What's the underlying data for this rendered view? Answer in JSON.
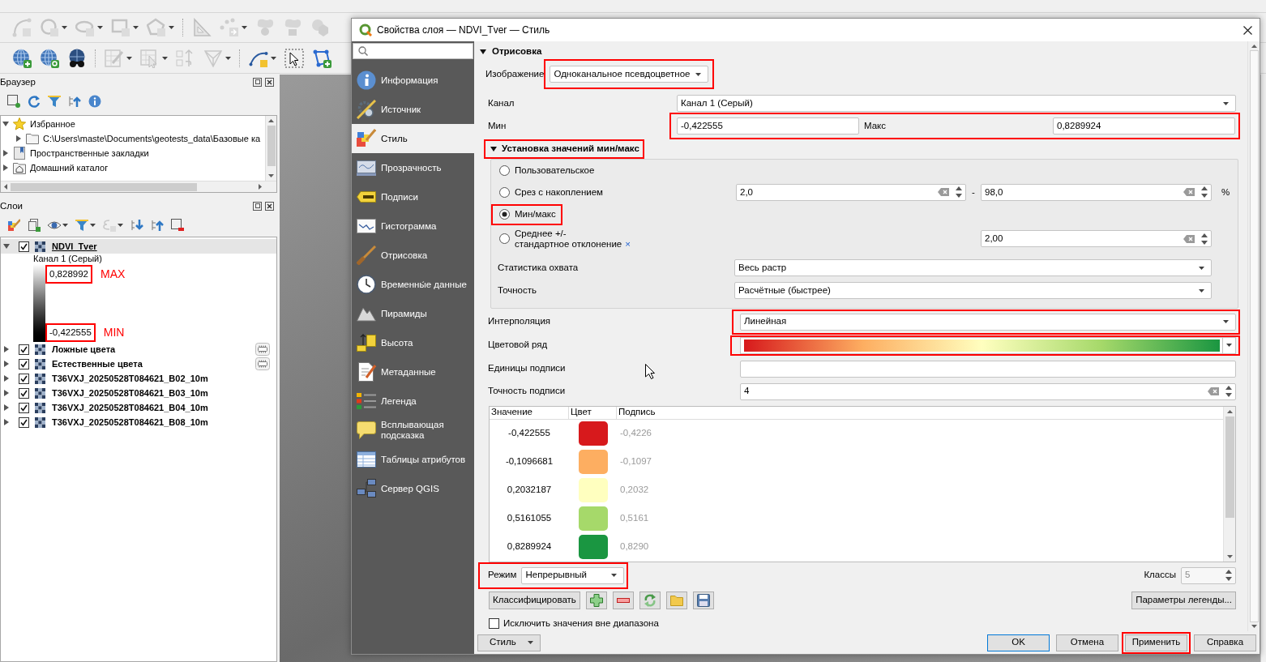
{
  "browser_panel": {
    "title": "Браузер",
    "items": [
      {
        "label": "Избранное",
        "expanded": true,
        "children": [
          {
            "label": "C:\\Users\\maste\\Documents\\geotests_data\\Базовые ка",
            "expanded": false
          }
        ]
      },
      {
        "label": "Пространственные закладки",
        "expanded": false
      },
      {
        "label": "Домашний каталог",
        "expanded": false
      }
    ]
  },
  "layers_panel": {
    "title": "Слои",
    "layers": [
      {
        "name": "NDVI_Tver",
        "checked": true,
        "expanded": true,
        "selected": true,
        "indicator": false,
        "legend": {
          "band": "Канал 1 (Серый)",
          "max": {
            "value": "0,828992",
            "note": "MAX",
            "highlighted": true
          },
          "min": {
            "value": "-0,422555",
            "note": "MIN",
            "highlighted": true
          }
        }
      },
      {
        "name": "Ложные цвета",
        "checked": true,
        "expanded": false,
        "selected": false,
        "indicator": true
      },
      {
        "name": "Естественные цвета",
        "checked": true,
        "expanded": false,
        "selected": false,
        "indicator": true
      },
      {
        "name": "T36VXJ_20250528T084621_B02_10m",
        "checked": true,
        "expanded": false,
        "selected": false,
        "indicator": false
      },
      {
        "name": "T36VXJ_20250528T084621_B03_10m",
        "checked": true,
        "expanded": false,
        "selected": false,
        "indicator": false
      },
      {
        "name": "T36VXJ_20250528T084621_B04_10m",
        "checked": true,
        "expanded": false,
        "selected": false,
        "indicator": false
      },
      {
        "name": "T36VXJ_20250528T084621_B08_10m",
        "checked": true,
        "expanded": false,
        "selected": false,
        "indicator": false
      }
    ]
  },
  "dialog": {
    "title": "Свойства слоя — NDVI_Tver — Стиль",
    "sections": [
      {
        "label": "Информация",
        "selected": false
      },
      {
        "label": "Источник",
        "selected": false
      },
      {
        "label": "Стиль",
        "selected": true
      },
      {
        "label": "Прозрачность",
        "selected": false
      },
      {
        "label": "Подписи",
        "selected": false
      },
      {
        "label": "Гистограмма",
        "selected": false
      },
      {
        "label": "Отрисовка",
        "selected": false
      },
      {
        "label": "Временны́е данные",
        "selected": false
      },
      {
        "label": "Пирамиды",
        "selected": false
      },
      {
        "label": "Высота",
        "selected": false
      },
      {
        "label": "Метаданные",
        "selected": false
      },
      {
        "label": "Легенда",
        "selected": false
      },
      {
        "label": "Всплывающая подсказка",
        "selected": false
      },
      {
        "label": "Таблицы атрибутов",
        "selected": false
      },
      {
        "label": "Сервер QGIS",
        "selected": false
      }
    ],
    "render": {
      "title": "Отрисовка",
      "expanded": true,
      "image": {
        "label": "Изображение",
        "value": "Одноканальное псевдоцветное",
        "highlighted": true
      },
      "band": {
        "label": "Канал",
        "value": "Канал 1 (Серый)"
      },
      "min": {
        "label": "Мин",
        "value": "-0,422555"
      },
      "max": {
        "label": "Макс",
        "value": "0,8289924"
      },
      "range_highlighted": true,
      "minmax": {
        "title": "Установка значений мин/макс",
        "expanded": true,
        "highlighted": true,
        "options": [
          {
            "kind": "plain",
            "label": "Пользовательское",
            "selected": false,
            "highlighted": false
          },
          {
            "kind": "cumulative",
            "label": "Срез с накоплением",
            "selected": false,
            "highlighted": false,
            "from": "2,0",
            "separator": "-",
            "to": "98,0",
            "unit": "%"
          },
          {
            "kind": "plain",
            "label": "Мин/макс",
            "selected": true,
            "highlighted": true
          },
          {
            "kind": "stddev",
            "label": "Среднее +/-\nстандартное отклонение",
            "mark": "×",
            "selected": false,
            "highlighted": false,
            "value": "2,00"
          }
        ],
        "extent": {
          "label": "Статистика охвата",
          "value": "Весь растр"
        },
        "accuracy": {
          "label": "Точность",
          "value": "Расчётные (быстрее)"
        }
      },
      "interpolation": {
        "label": "Интерполяция",
        "value": "Линейная",
        "highlighted": true
      },
      "color_ramp": {
        "label": "Цветовой ряд",
        "highlighted": true
      },
      "label_unit": {
        "label": "Единицы подписи"
      },
      "label_precision": {
        "label": "Точность подписи",
        "value": "4"
      },
      "table": {
        "columns": [
          "Значение",
          "Цвет",
          "Подпись"
        ],
        "rows": [
          {
            "value": "-0,422555",
            "color": "#d7191c",
            "label": "-0,4226"
          },
          {
            "value": "-0,1096681",
            "color": "#fdae61",
            "label": "-0,1097"
          },
          {
            "value": "0,2032187",
            "color": "#ffffbf",
            "label": "0,2032"
          },
          {
            "value": "0,5161055",
            "color": "#a6d96a",
            "label": "0,5161"
          },
          {
            "value": "0,8289924",
            "color": "#1a9641",
            "label": "0,8290"
          }
        ]
      },
      "mode": {
        "label": "Режим",
        "value": "Непрерывный",
        "highlighted": true
      },
      "classes": {
        "label": "Классы",
        "value": "5",
        "disabled": true
      },
      "classify_button": "Классифицировать",
      "legend_button": "Параметры легенды...",
      "clip": {
        "label": "Исключить значения вне диапазона",
        "checked": false
      }
    },
    "footer": {
      "style_button": "Стиль",
      "buttons": [
        {
          "label": "OK",
          "default": true,
          "highlighted": false
        },
        {
          "label": "Отмена",
          "default": false,
          "highlighted": false
        },
        {
          "label": "Применить",
          "default": false,
          "highlighted": true
        },
        {
          "label": "Справка",
          "default": false,
          "highlighted": false
        }
      ]
    }
  }
}
